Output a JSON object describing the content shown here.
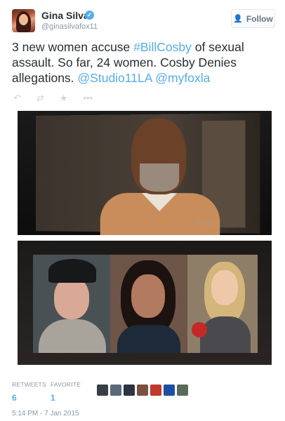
{
  "user": {
    "name": "Gina Silva",
    "handle": "@ginasilvafox11",
    "verified_mark": "✓"
  },
  "follow_button": {
    "label": "Follow",
    "icon": "add-person-icon"
  },
  "tweet": {
    "text_part1": "3 new women accuse ",
    "hashtag": "#BillCosby",
    "text_part2": " of sexual assault. So far, 24 women. Cosby Denies allegations. ",
    "mention1": "@Studio11LA",
    "text_part3": " ",
    "mention2": "@myfoxla"
  },
  "photos": {
    "photo1_watermark": "TVlogic"
  },
  "actions": {
    "reply": "↶",
    "retweet": "⇄",
    "favorite": "★",
    "more": "•••"
  },
  "stats": {
    "retweets_label": "RETWEETS",
    "retweets_count": "6",
    "favorites_label": "FAVORITE",
    "favorites_count": "1"
  },
  "favoriters_colors": [
    "#3a3f47",
    "#5a6a7a",
    "#2d3340",
    "#7a5040",
    "#c0392b",
    "#1f4fa0",
    "#5a6a5a"
  ],
  "timestamp": "5:14 PM - 7 Jan 2015",
  "colors": {
    "link": "#55acee",
    "text": "#292f33",
    "muted": "#8899a6"
  }
}
